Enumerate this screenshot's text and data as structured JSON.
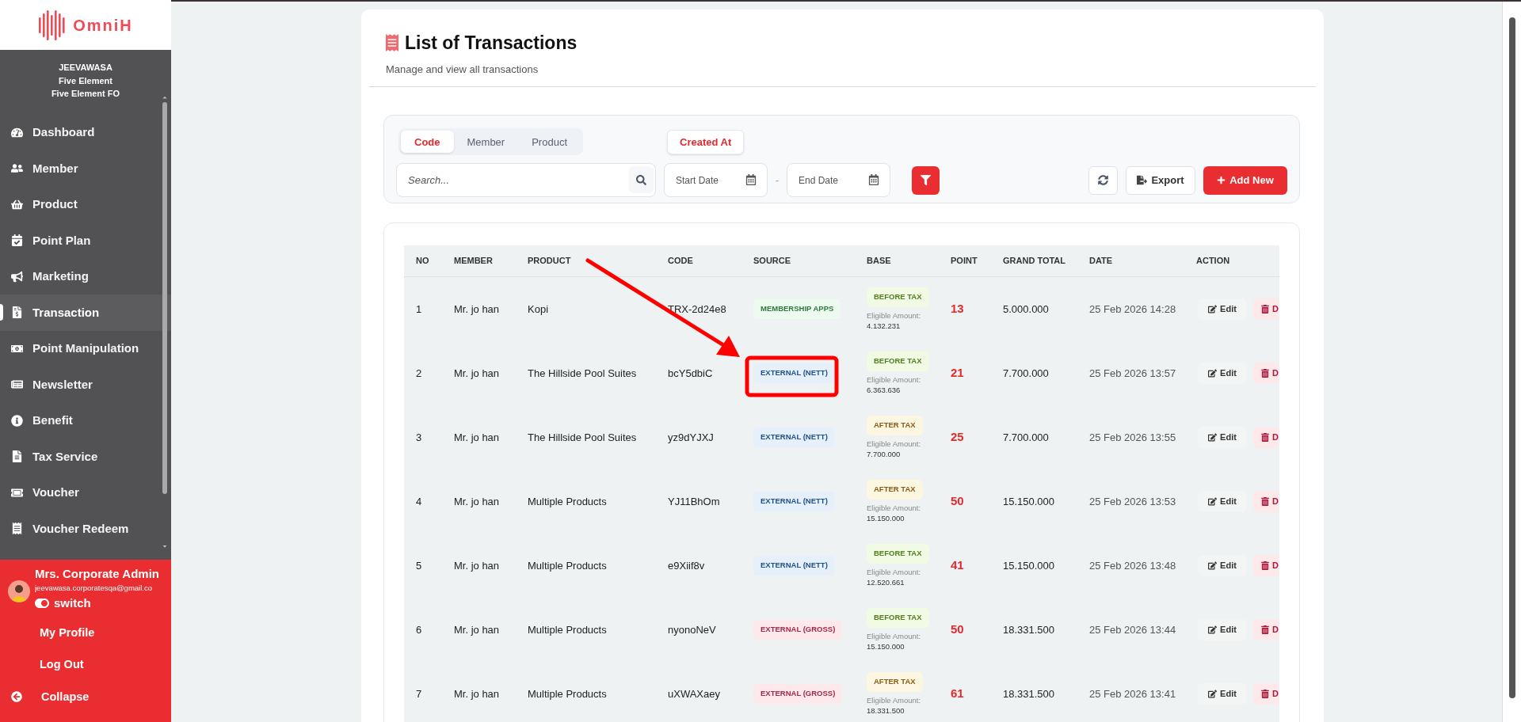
{
  "sidebar": {
    "logo": "OmniH",
    "org_lines": [
      "JEEVAWASA",
      "Five Element",
      "Five Element FO"
    ],
    "items": [
      {
        "label": "Dashboard",
        "selected": false
      },
      {
        "label": "Member",
        "selected": false
      },
      {
        "label": "Product",
        "selected": false
      },
      {
        "label": "Point Plan",
        "selected": false
      },
      {
        "label": "Marketing",
        "selected": false
      },
      {
        "label": "Transaction",
        "selected": true
      },
      {
        "label": "Point Manipulation",
        "selected": false
      },
      {
        "label": "Newsletter",
        "selected": false
      },
      {
        "label": "Benefit",
        "selected": false
      },
      {
        "label": "Tax Service",
        "selected": false
      },
      {
        "label": "Voucher",
        "selected": false
      },
      {
        "label": "Voucher Redeem",
        "selected": false
      }
    ],
    "user": {
      "name": "Mrs. Corporate Admin",
      "email": "jeevawasa.corporatesqa@gmail.co",
      "switch_label": "switch",
      "switch_on": true
    },
    "links": [
      "My Profile",
      "Log Out"
    ],
    "collapse": "Collapse"
  },
  "header": {
    "title": "List of Transactions",
    "subtitle": "Manage and view all transactions"
  },
  "filters": {
    "search_tabs": [
      {
        "label": "Code",
        "selected": true
      },
      {
        "label": "Member",
        "selected": false
      },
      {
        "label": "Product",
        "selected": false
      }
    ],
    "date_tabs": [
      {
        "label": "Created At",
        "selected": true
      }
    ],
    "search": {
      "placeholder": "Search..."
    },
    "start_date": {
      "placeholder": "Start Date"
    },
    "separator": "-",
    "end_date": {
      "placeholder": "End Date"
    },
    "export": "Export",
    "add_new": "Add New"
  },
  "table": {
    "columns": [
      "NO",
      "MEMBER",
      "PRODUCT",
      "CODE",
      "SOURCE",
      "BASE",
      "POINT",
      "GRAND TOTAL",
      "DATE",
      "ACTION"
    ],
    "rows": [
      {
        "no": "1",
        "member": "Mr. jo han",
        "product": "Kopi",
        "code": "TRX-2d24e8",
        "source": {
          "label": "MEMBERSHIP APPS",
          "kind": "membership"
        },
        "base": {
          "label": "BEFORE TAX",
          "kind": "before"
        },
        "eligible_label": "Eligible Amount:",
        "eligible_amount": "4.132.231",
        "point": "13",
        "grand_total": "5.000.000",
        "date": "25 Feb 2026 14:28",
        "edit": "Edit",
        "delete": "D"
      },
      {
        "no": "2",
        "member": "Mr. jo han",
        "product": "The Hillside Pool Suites",
        "code": "bcY5dbiC",
        "source": {
          "label": "EXTERNAL (NETT)",
          "kind": "nett"
        },
        "base": {
          "label": "BEFORE TAX",
          "kind": "before"
        },
        "eligible_label": "Eligible Amount:",
        "eligible_amount": "6.363.636",
        "point": "21",
        "grand_total": "7.700.000",
        "date": "25 Feb 2026 13:57",
        "edit": "Edit",
        "delete": "D"
      },
      {
        "no": "3",
        "member": "Mr. jo han",
        "product": "The Hillside Pool Suites",
        "code": "yz9dYJXJ",
        "source": {
          "label": "EXTERNAL (NETT)",
          "kind": "nett"
        },
        "base": {
          "label": "AFTER TAX",
          "kind": "after"
        },
        "eligible_label": "Eligible Amount:",
        "eligible_amount": "7.700.000",
        "point": "25",
        "grand_total": "7.700.000",
        "date": "25 Feb 2026 13:55",
        "edit": "Edit",
        "delete": "D"
      },
      {
        "no": "4",
        "member": "Mr. jo han",
        "product": "Multiple Products",
        "code": "YJ11BhOm",
        "source": {
          "label": "EXTERNAL (NETT)",
          "kind": "nett"
        },
        "base": {
          "label": "AFTER TAX",
          "kind": "after"
        },
        "eligible_label": "Eligible Amount:",
        "eligible_amount": "15.150.000",
        "point": "50",
        "grand_total": "15.150.000",
        "date": "25 Feb 2026 13:53",
        "edit": "Edit",
        "delete": "D"
      },
      {
        "no": "5",
        "member": "Mr. jo han",
        "product": "Multiple Products",
        "code": "e9Xiif8v",
        "source": {
          "label": "EXTERNAL (NETT)",
          "kind": "nett"
        },
        "base": {
          "label": "BEFORE TAX",
          "kind": "before"
        },
        "eligible_label": "Eligible Amount:",
        "eligible_amount": "12.520.661",
        "point": "41",
        "grand_total": "15.150.000",
        "date": "25 Feb 2026 13:48",
        "edit": "Edit",
        "delete": "D"
      },
      {
        "no": "6",
        "member": "Mr. jo han",
        "product": "Multiple Products",
        "code": "nyonoNeV",
        "source": {
          "label": "EXTERNAL (GROSS)",
          "kind": "gross"
        },
        "base": {
          "label": "BEFORE TAX",
          "kind": "before"
        },
        "eligible_label": "Eligible Amount:",
        "eligible_amount": "15.150.000",
        "point": "50",
        "grand_total": "18.331.500",
        "date": "25 Feb 2026 13:44",
        "edit": "Edit",
        "delete": "D"
      },
      {
        "no": "7",
        "member": "Mr. jo han",
        "product": "Multiple Products",
        "code": "uXWAXaey",
        "source": {
          "label": "EXTERNAL (GROSS)",
          "kind": "gross"
        },
        "base": {
          "label": "AFTER TAX",
          "kind": "after"
        },
        "eligible_label": "Eligible Amount:",
        "eligible_amount": "18.331.500",
        "point": "61",
        "grand_total": "18.331.500",
        "date": "25 Feb 2026 13:41",
        "edit": "Edit",
        "delete": "D"
      }
    ]
  }
}
